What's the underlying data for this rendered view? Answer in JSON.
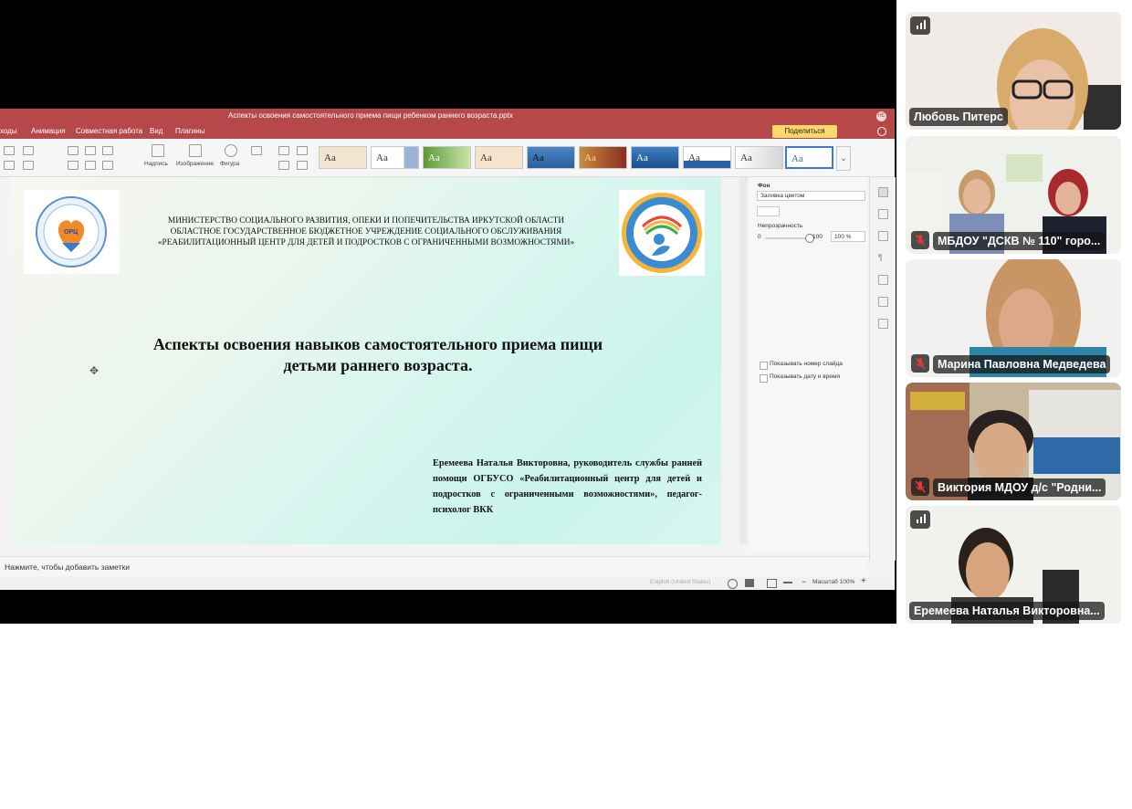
{
  "ppt": {
    "window_title": "Аспекты освоения самостоятельного приема пищи ребенком раннего возраста.pptx",
    "user_initials": "НЕ",
    "menu": [
      "ходы",
      "Анимация",
      "Совместная работа",
      "Вид",
      "Плагины"
    ],
    "share_label": "Поделиться",
    "ribbon": {
      "label_text": "Надпись",
      "label_image": "Изображение",
      "label_shape": "Фигура",
      "theme_sample": "Aa"
    },
    "slide": {
      "org_line1": "МИНИСТЕРСТВО СОЦИАЛЬНОГО РАЗВИТИЯ, ОПЕКИ И ПОПЕЧИТЕЛЬСТВА ИРКУТСКОЙ ОБЛАСТИ",
      "org_line2": "ОБЛАСТНОЕ ГОСУДАРСТВЕННОЕ БЮДЖЕТНОЕ УЧРЕЖДЕНИЕ СОЦИАЛЬНОГО ОБСЛУЖИВАНИЯ",
      "org_line3": "«РЕАБИЛИТАЦИОННЫЙ ЦЕНТР ДЛЯ ДЕТЕЙ И ПОДРОСТКОВ С ОГРАНИЧЕННЫМИ ВОЗМОЖНОСТЯМИ»",
      "title_line1": "Аспекты освоения навыков самостоятельного приема пищи",
      "title_line2": "детьми раннего возраста.",
      "author": "Еремеева Наталья Викторовна, руководитель службы ранней помощи ОГБУСО «Реабилитационный центр для детей и подростков с ограниченными возможностями», педагог-психолог ВКК",
      "logo_left_text": "ОРЦ"
    },
    "pane": {
      "background_label": "Фон",
      "fill_value": "Заливка цветом",
      "opacity_label": "Непрозрачность",
      "opacity_min": "0",
      "opacity_max": "100",
      "opacity_value": "100 %",
      "opacity_level": 1.0,
      "show_slide_number": "Показывать номер слайда",
      "show_date_time": "Показывать дату и время"
    },
    "notes_placeholder": "Нажмите, чтобы добавить заметки",
    "status": {
      "language": "English (United States)",
      "zoom": "Масштаб 100%"
    }
  },
  "participants": [
    {
      "name": "Любовь Питерс",
      "muted": false,
      "speaking_indicator": true
    },
    {
      "name": "МБДОУ \"ДСКВ № 110\" горо...",
      "muted": true
    },
    {
      "name": "Марина Павловна Медведева",
      "muted": true
    },
    {
      "name": "Виктория МДОУ д/с \"Родни...",
      "muted": true
    },
    {
      "name": "Еремеева Наталья Викторовна...",
      "muted": false,
      "speaking_indicator": true,
      "active": true
    }
  ],
  "colors": {
    "ppt_accent": "#b7484a",
    "share_button": "#ffd86b",
    "mic_muted": "#e0393e",
    "active_border": "#8ea8ff"
  }
}
